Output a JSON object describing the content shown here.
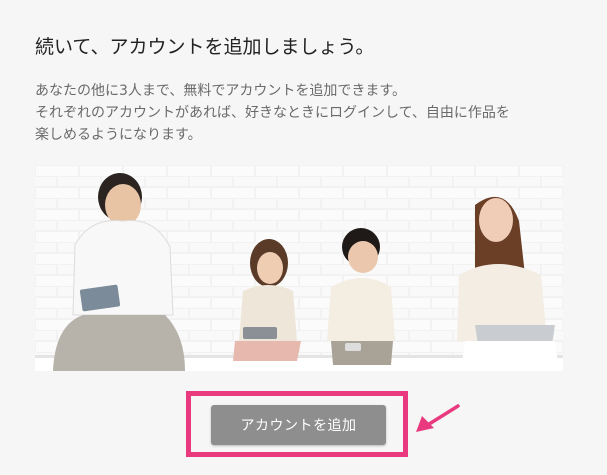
{
  "heading": "続いて、アカウントを追加しましょう。",
  "description": {
    "line1": "あなたの他に3人まで、無料でアカウントを追加できます。",
    "line2": "それぞれのアカウントがあれば、好きなときにログインして、自由に作品を",
    "line3": "楽しめるようになります。"
  },
  "image": {
    "subject": "family-photo"
  },
  "add_account": {
    "label": "アカウントを追加"
  },
  "colors": {
    "highlight": "#ea3a7f",
    "button": "#8e8e8e",
    "background": "#f6f6f6"
  },
  "icons": {
    "pointer": "arrow-icon"
  }
}
